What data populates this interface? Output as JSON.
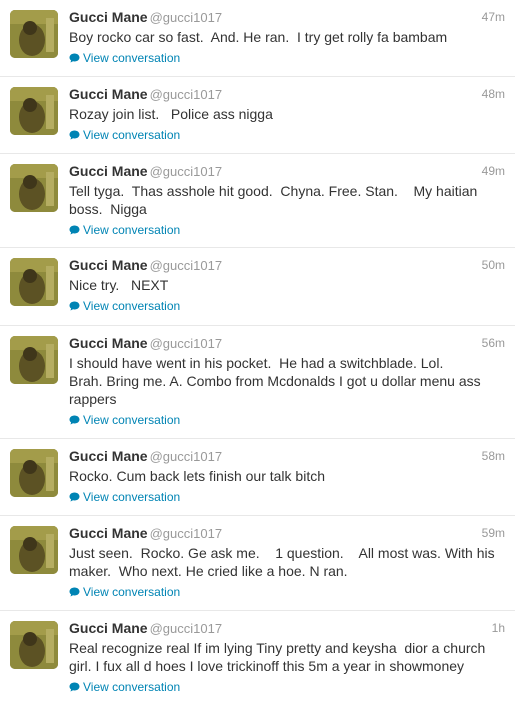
{
  "tweets": [
    {
      "name": "Gucci Mane",
      "handle": "@gucci1017",
      "time": "47m",
      "text": "Boy rocko car so fast.  And. He ran.  I try get rolly fa bambam",
      "link": "View conversation"
    },
    {
      "name": "Gucci Mane",
      "handle": "@gucci1017",
      "time": "48m",
      "text": "Rozay join list.   Police ass nigga",
      "link": "View conversation"
    },
    {
      "name": "Gucci Mane",
      "handle": "@gucci1017",
      "time": "49m",
      "text": "Tell tyga.  Thas asshole hit good.  Chyna. Free. Stan.    My haitian\nboss.  Nigga",
      "link": "View conversation"
    },
    {
      "name": "Gucci Mane",
      "handle": "@gucci1017",
      "time": "50m",
      "text": "Nice try.   NEXT",
      "link": "View conversation"
    },
    {
      "name": "Gucci Mane",
      "handle": "@gucci1017",
      "time": "56m",
      "text": "I should have went in his pocket.  He had a switchblade. Lol.\nBrah. Bring me. A. Combo from Mcdonalds I got u dollar menu ass\nrappers",
      "link": "View conversation"
    },
    {
      "name": "Gucci Mane",
      "handle": "@gucci1017",
      "time": "58m",
      "text": "Rocko. Cum back lets finish our talk bitch",
      "link": "View conversation"
    },
    {
      "name": "Gucci Mane",
      "handle": "@gucci1017",
      "time": "59m",
      "text": "Just seen.  Rocko. Ge ask me.    1 question.    All most was. With his\nmaker.  Who next. He cried like a hoe. N ran.",
      "link": "View conversation"
    },
    {
      "name": "Gucci Mane",
      "handle": "@gucci1017",
      "time": "1h",
      "text": "Real recognize real If im lying Tiny pretty and keysha  dior a church\ngirl. I fux all d hoes I love trickinoff this 5m a year in showmoney",
      "link": "View conversation"
    }
  ],
  "colors": {
    "link": "#0084b4",
    "name": "#333333",
    "meta": "#999999"
  },
  "icons": {
    "avatar": "avatar-photo",
    "conversation": "speech-bubble-icon"
  }
}
